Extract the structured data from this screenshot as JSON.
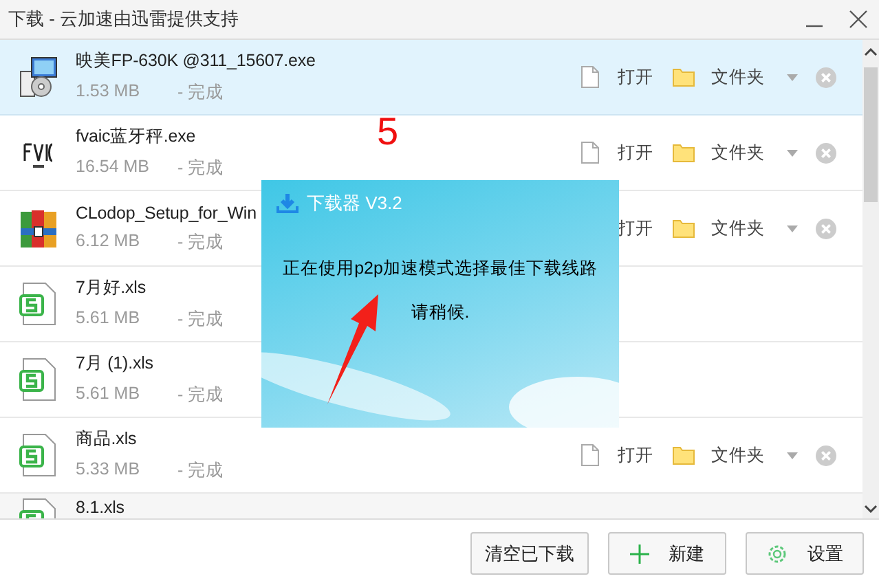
{
  "window": {
    "title": "下载 - 云加速由迅雷提供支持"
  },
  "downloads": [
    {
      "name": "映美FP-630K @311_15607.exe",
      "size": "1.53 MB",
      "status": "- 完成",
      "selected": true,
      "open_icon": true,
      "open_label": "打开",
      "folder_label": "文件夹"
    },
    {
      "name": "fvaic蓝牙秤.exe",
      "size": "16.54 MB",
      "status": "- 完成",
      "selected": false,
      "open_icon": true,
      "open_label": "打开",
      "folder_label": "文件夹"
    },
    {
      "name": "CLodop_Setup_for_Win",
      "size": "6.12 MB",
      "status": "- 完成",
      "selected": false,
      "open_icon": false,
      "open_label": "打开",
      "folder_label": "文件夹"
    },
    {
      "name": "7月好.xls",
      "size": "5.61 MB",
      "status": "- 完成",
      "selected": false
    },
    {
      "name": "7月 (1).xls",
      "size": "5.61 MB",
      "status": "- 完成",
      "selected": false
    },
    {
      "name": "商品.xls",
      "size": "5.33 MB",
      "status": "- 完成",
      "selected": false,
      "open_icon": true,
      "open_label": "打开",
      "folder_label": "文件夹"
    },
    {
      "name": "8.1.xls",
      "selected": false
    }
  ],
  "marker": "5",
  "popup": {
    "title": "下载器 V3.2",
    "message": "正在使用p2p加速模式选择最佳下载线路",
    "note": "请稍候."
  },
  "buttons": [
    {
      "label": "清空已下载",
      "kind": "plain"
    },
    {
      "label": "新建",
      "kind": "new"
    },
    {
      "label": "设置",
      "kind": "settings"
    }
  ]
}
